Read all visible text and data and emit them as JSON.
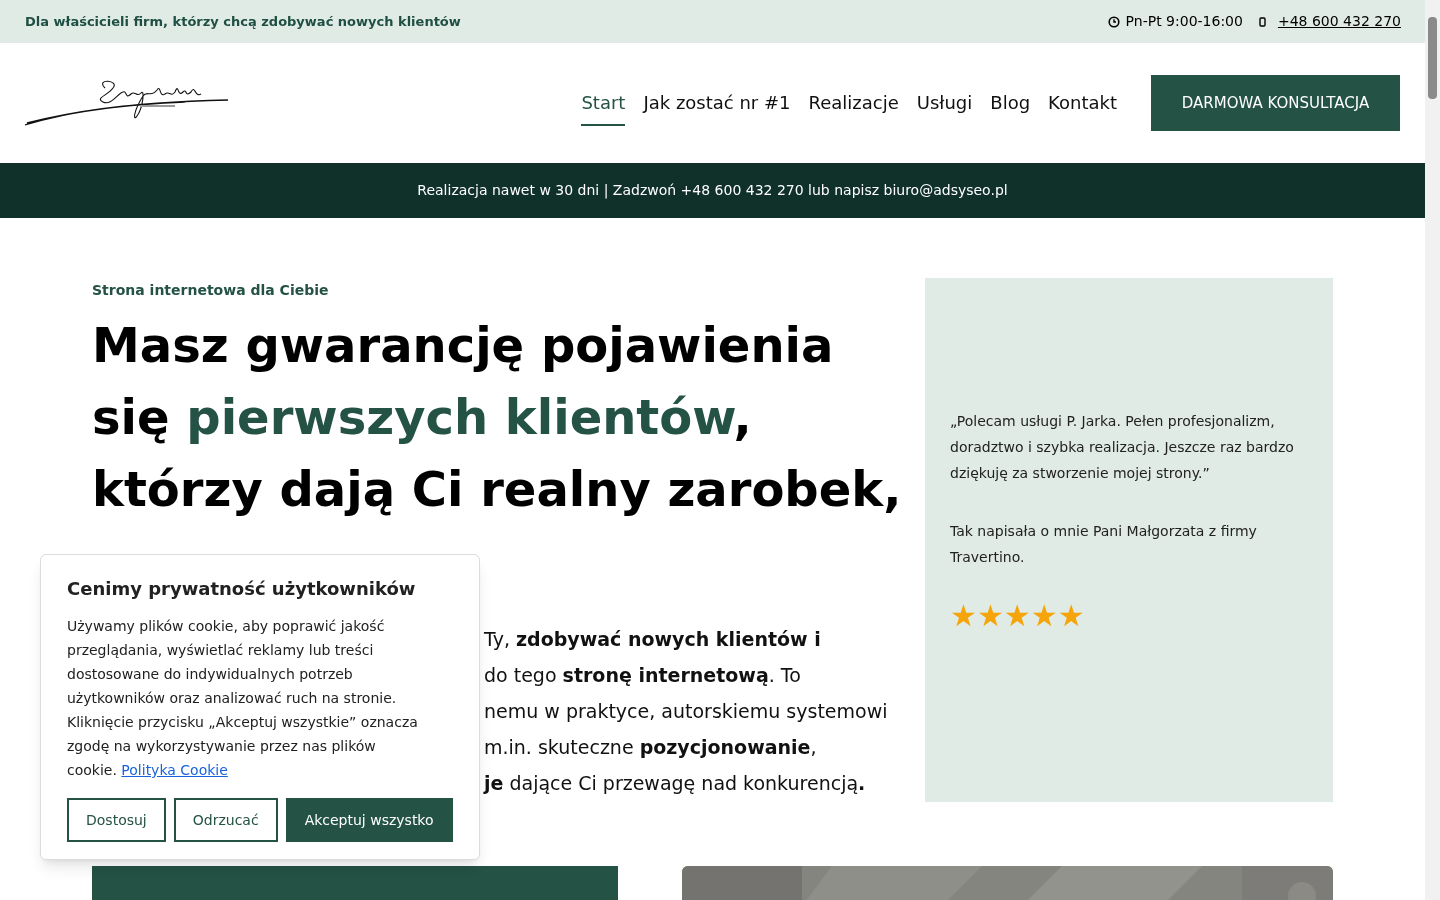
{
  "top_bar": {
    "tagline": "Dla właścicieli firm, którzy chcą zdobywać nowych klientów",
    "hours": "Pn-Pt 9:00-16:00",
    "phone": "+48 600 432 270"
  },
  "nav": {
    "items": [
      {
        "label": "Start",
        "selected": true
      },
      {
        "label": "Jak zostać nr #1",
        "selected": false
      },
      {
        "label": "Realizacje",
        "selected": false
      },
      {
        "label": "Usługi",
        "selected": false
      },
      {
        "label": "Blog",
        "selected": false
      },
      {
        "label": "Kontakt",
        "selected": false
      }
    ],
    "cta": "DARMOWA KONSULTACJA"
  },
  "info_bar": "Realizacja nawet w 30 dni | Zadzwoń +48 600 432 270 lub napisz biuro@adsyseo.pl",
  "hero": {
    "eyebrow": "Strona internetowa dla Ciebie",
    "heading": [
      {
        "text": "Masz gwarancję pojawienia się ",
        "highlight": false
      },
      {
        "text": "pierwszych klientów",
        "highlight": true
      },
      {
        "text": ", którzy dają Ci realny zarobek,",
        "highlight": false
      }
    ],
    "paragraph_lines": [
      "Ty, **zdobywać nowych klientów i**",
      "do tego **stronę internetową**. To",
      "nemu w praktyce, autorskiemu systemowi",
      "m.in. skuteczne **pozycjonowanie**,",
      "**je** dające Ci przewagę nad konkurencją**.**"
    ]
  },
  "testimonial": {
    "quote": "„Polecam usługi P. Jarka. Pełen profesjonalizm, doradztwo i szybka realizacja. Jeszcze raz bardzo dziękuję za stworzenie mojej strony.”",
    "source": "Tak napisała o mnie Pani Małgorzata z firmy Travertino.",
    "stars": 5
  },
  "cookie_dialog": {
    "title": "Cenimy prywatność użytkowników",
    "text": "Używamy plików cookie, aby poprawić jakość przeglądania, wyświetlać reklamy lub treści dostosowane do indywidualnych potrzeb użytkowników oraz analizować ruch na stronie. Kliknięcie przycisku „Akceptuj wszystkie” oznacza zgodę na wykorzystywanie przez nas plików cookie.",
    "link": "Polityka Cookie",
    "buttons": [
      {
        "label": "Dostosuj",
        "kind": "outline"
      },
      {
        "label": "Odrzucać",
        "kind": "outline"
      },
      {
        "label": "Akceptuj wszystko",
        "kind": "primary"
      }
    ]
  }
}
